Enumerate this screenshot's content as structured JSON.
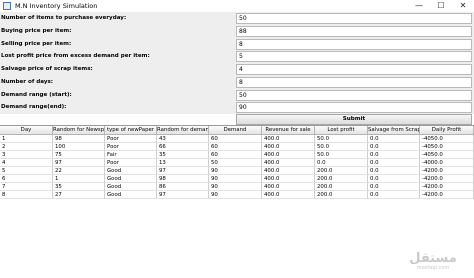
{
  "window": {
    "title": "M.N Inventory Simulation",
    "minimize_glyph": "—",
    "maximize_glyph": "☐",
    "close_glyph": "✕"
  },
  "form": {
    "fields": [
      {
        "label": "Number of items to purchase everyday:",
        "value": "50"
      },
      {
        "label": "Buying price per item:",
        "value": "88"
      },
      {
        "label": "Selling price per item:",
        "value": "8"
      },
      {
        "label": "Lost profit price from excess demand per item:",
        "value": "5"
      },
      {
        "label": "Salvage price of scrap items:",
        "value": "4"
      },
      {
        "label": "Number of days:",
        "value": "8"
      },
      {
        "label": "Demand range (start):",
        "value": "50"
      },
      {
        "label": "Demand range(end):",
        "value": "90"
      }
    ],
    "submit_label": "Submit"
  },
  "table": {
    "columns": [
      "Day",
      "Random for Newsp.",
      "type of newPaper",
      "Random for demand",
      "Demand",
      "Revenue for sale",
      "Lost profit",
      "Salvage from Scrap",
      "Daily Profit"
    ],
    "rows": [
      [
        "1",
        "98",
        "Poor",
        "43",
        "60",
        "400.0",
        "50.0",
        "0.0",
        "-4050.0"
      ],
      [
        "2",
        "100",
        "Poor",
        "66",
        "60",
        "400.0",
        "50.0",
        "0.0",
        "-4050.0"
      ],
      [
        "3",
        "75",
        "Fair",
        "35",
        "60",
        "400.0",
        "50.0",
        "0.0",
        "-4050.0"
      ],
      [
        "4",
        "97",
        "Poor",
        "13",
        "50",
        "400.0",
        "0.0",
        "0.0",
        "-4000.0"
      ],
      [
        "5",
        "22",
        "Good",
        "97",
        "90",
        "400.0",
        "200.0",
        "0.0",
        "-4200.0"
      ],
      [
        "6",
        "1",
        "Good",
        "98",
        "90",
        "400.0",
        "200.0",
        "0.0",
        "-4200.0"
      ],
      [
        "7",
        "35",
        "Good",
        "86",
        "90",
        "400.0",
        "200.0",
        "0.0",
        "-4200.0"
      ],
      [
        "8",
        "27",
        "Good",
        "97",
        "90",
        "400.0",
        "200.0",
        "0.0",
        "-4200.0"
      ]
    ]
  },
  "watermark": {
    "arabic": "مستقل",
    "latin": "mostaql.com"
  }
}
